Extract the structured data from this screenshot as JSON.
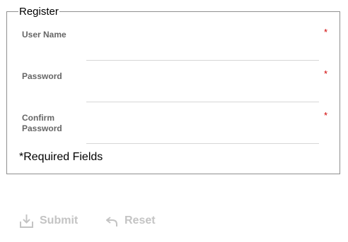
{
  "form": {
    "legend": "Register",
    "fields": [
      {
        "label": "User Name",
        "required_mark": "*",
        "value": ""
      },
      {
        "label": "Password",
        "required_mark": "*",
        "value": ""
      },
      {
        "label": "Confirm Password",
        "required_mark": "*",
        "value": ""
      }
    ],
    "required_note": "*Required Fields"
  },
  "actions": {
    "submit_label": "Submit",
    "submit_icon": "download-icon",
    "reset_label": "Reset",
    "reset_icon": "undo-icon",
    "disabled_color": "#c4c4c4"
  },
  "colors": {
    "required_star": "#d00000",
    "label_text": "#666666",
    "border": "#8f8f8f"
  }
}
